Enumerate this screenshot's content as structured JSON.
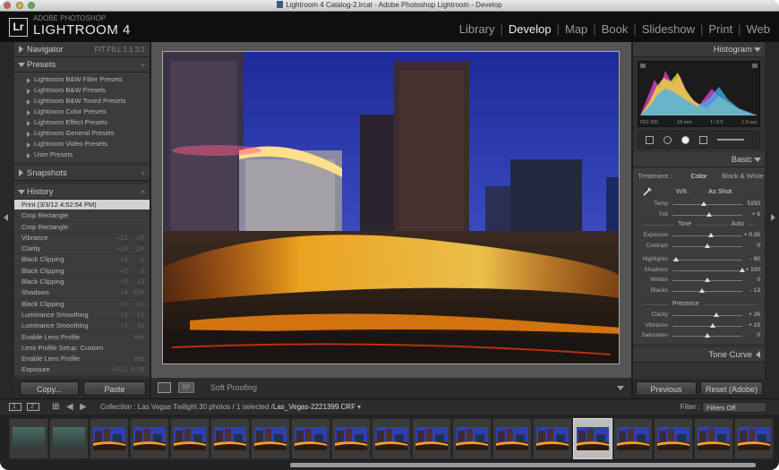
{
  "window": {
    "title": "Lightroom 4 Catalog-2.lrcat - Adobe Photoshop Lightroom - Develop"
  },
  "brand": {
    "logo": "Lr",
    "small": "ADOBE PHOTOSHOP",
    "big": "LIGHTROOM 4"
  },
  "modules": [
    "Library",
    "Develop",
    "Map",
    "Book",
    "Slideshow",
    "Print",
    "Web"
  ],
  "active_module": "Develop",
  "left": {
    "navigator": {
      "title": "Navigator",
      "zoom": "FIT   FILL   1:1   3:1"
    },
    "presets": {
      "title": "Presets",
      "add": "+",
      "items": [
        "Lightroom B&W Filter Presets",
        "Lightroom B&W Presets",
        "Lightroom B&W Toned Presets",
        "Lightroom Color Presets",
        "Lightroom Effect Presets",
        "Lightroom General Presets",
        "Lightroom Video Presets",
        "User Presets"
      ]
    },
    "snapshots": {
      "title": "Snapshots",
      "add": "+"
    },
    "history": {
      "title": "History",
      "clear": "×",
      "items": [
        {
          "label": "Print (3/3/12 4:52:54 PM)",
          "a": "",
          "b": ""
        },
        {
          "label": "Crop Rectangle",
          "a": "",
          "b": ""
        },
        {
          "label": "Crop Rectangle",
          "a": "",
          "b": ""
        },
        {
          "label": "Vibrance",
          "a": "+21",
          "b": "15"
        },
        {
          "label": "Clarity",
          "a": "+13",
          "b": "26"
        },
        {
          "label": "Black Clipping",
          "a": "+1",
          "b": "1"
        },
        {
          "label": "Black Clipping",
          "a": "+2",
          "b": "3"
        },
        {
          "label": "Black Clipping",
          "a": "+5",
          "b": "13"
        },
        {
          "label": "Shadows",
          "a": "+4",
          "b": "100"
        },
        {
          "label": "Black Clipping",
          "a": "+1",
          "b": "21"
        },
        {
          "label": "Luminance Smoothing",
          "a": "+1",
          "b": "12"
        },
        {
          "label": "Luminance Smoothing",
          "a": "+1",
          "b": "32"
        },
        {
          "label": "Enable Lens Profile",
          "a": "",
          "b": "Yes"
        },
        {
          "label": "Lens Profile Setup: Custom",
          "a": "",
          "b": ""
        },
        {
          "label": "Enable Lens Profile",
          "a": "",
          "b": "Yes"
        },
        {
          "label": "Exposure",
          "a": "+0.11",
          "b": "0.35"
        }
      ]
    },
    "copy_label": "Copy...",
    "paste_label": "Paste"
  },
  "toolbar": {
    "view_label": "Y|Y",
    "soft_proofing": "Soft Proofing"
  },
  "right": {
    "histogram": {
      "title": "Histogram",
      "values": [
        "ISO 200",
        "16 mm",
        "f / 9.0",
        "1.0 sec"
      ]
    },
    "basic": {
      "title": "Basic",
      "treatment_label": "Treatment :",
      "color_label": "Color",
      "bw_label": "Black & White",
      "wb_label": "WB :",
      "wb_value": "As Shot",
      "tone_label": "Tone",
      "auto_label": "Auto",
      "presence_label": "Presence",
      "sliders_wb": [
        {
          "name": "Temp",
          "value": "5150",
          "pos": 0.45
        },
        {
          "name": "Tint",
          "value": "+ 6",
          "pos": 0.53
        }
      ],
      "sliders_tone": [
        {
          "name": "Exposure",
          "value": "+ 0.35",
          "pos": 0.55
        },
        {
          "name": "Contrast",
          "value": "0",
          "pos": 0.5
        },
        {
          "name": "Highlights",
          "value": "- 90",
          "pos": 0.05
        },
        {
          "name": "Shadows",
          "value": "+ 100",
          "pos": 1.0
        },
        {
          "name": "Whites",
          "value": "0",
          "pos": 0.5
        },
        {
          "name": "Blacks",
          "value": "- 13",
          "pos": 0.42
        }
      ],
      "sliders_presence": [
        {
          "name": "Clarity",
          "value": "+ 26",
          "pos": 0.63
        },
        {
          "name": "Vibrance",
          "value": "+ 15",
          "pos": 0.58
        },
        {
          "name": "Saturation",
          "value": "0",
          "pos": 0.5
        }
      ]
    },
    "tone_curve_title": "Tone Curve",
    "previous_label": "Previous",
    "reset_label": "Reset (Adobe)"
  },
  "filmstrip": {
    "page1": "1",
    "page2": "2",
    "collection_prefix": "Collection : Las Vegas Twilight",
    "count": "30 photos / 1 selected /",
    "filename": "Las_Vegas-2221399.CRF",
    "filter_label": "Filter :",
    "filter_value": "Filters Off",
    "thumb_count": 19,
    "selected_index": 14
  },
  "colors": {
    "accent": "#e6e6e6",
    "panel": "#323232",
    "sky": "#2b3aa8",
    "light_trail": "#ff9a1a"
  },
  "icons": [
    "apple-icon",
    "disclosure-triangle-icon",
    "crop-icon",
    "spot-removal-icon",
    "red-eye-icon",
    "graduated-filter-icon",
    "brush-icon",
    "white-balance-eyedropper-icon",
    "grid-icon",
    "back-arrow-icon",
    "forward-arrow-icon"
  ]
}
